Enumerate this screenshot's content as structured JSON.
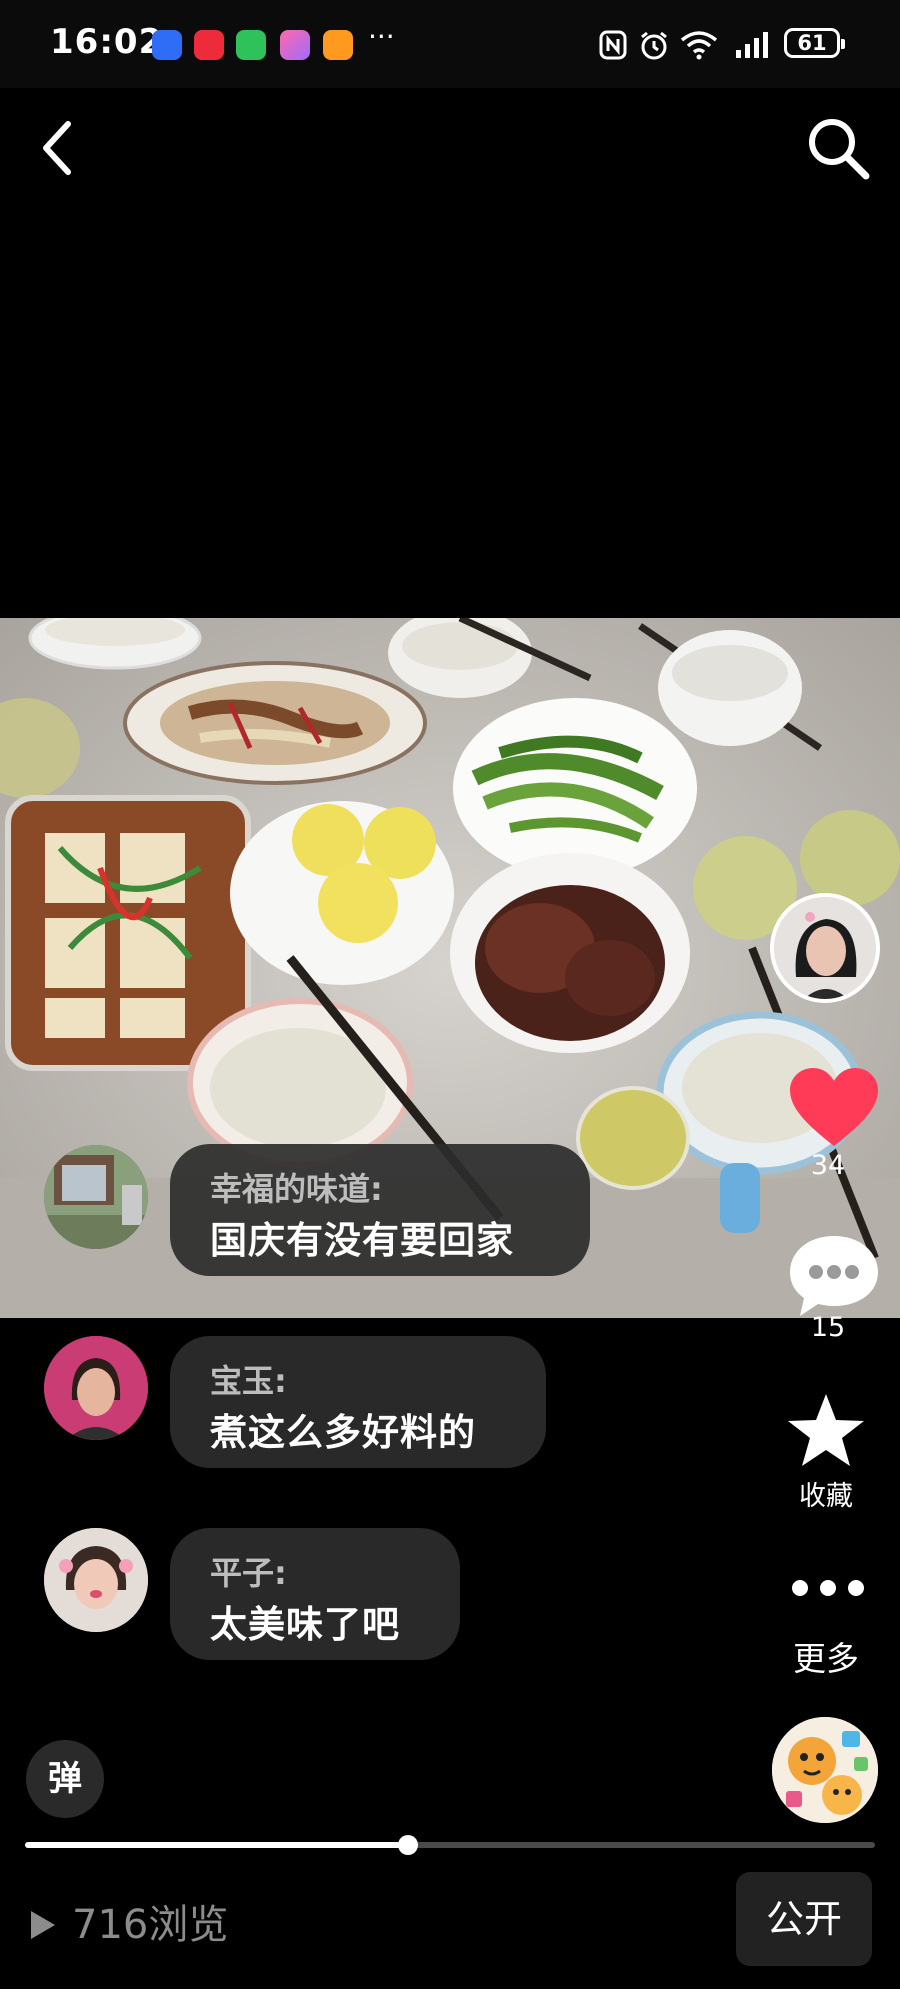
{
  "status_bar": {
    "time": "16:02",
    "battery": "61",
    "more": "···"
  },
  "comments": [
    {
      "user": "幸福的味道:",
      "text": "国庆有没有要回家"
    },
    {
      "user": "宝玉:",
      "text": "煮这么多好料的"
    },
    {
      "user": "平子:",
      "text": "太美味了吧"
    }
  ],
  "actions": {
    "like_count": "34",
    "comment_count": "15",
    "favorite_label": "收藏",
    "more_label": "更多"
  },
  "bottom": {
    "danmaku_label": "弹",
    "views": "716浏览",
    "public_label": "公开",
    "progress_percent": 45
  },
  "colors": {
    "like": "#ff3b57",
    "bubble": "#2d2d2d",
    "background": "#000000"
  }
}
